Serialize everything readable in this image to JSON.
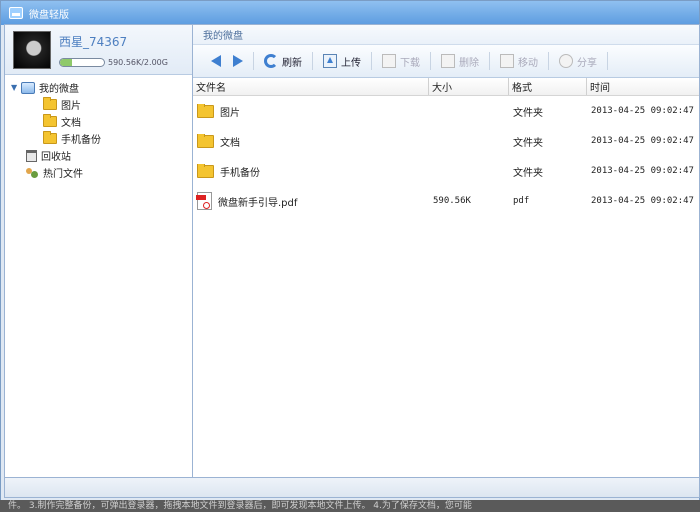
{
  "window": {
    "title": "微盘轻版"
  },
  "profile": {
    "username": "西星_74367",
    "quota_text": "590.56K/2.00G",
    "quota_fraction": 0.28
  },
  "tree": {
    "root_label": "我的微盘",
    "children": [
      "图片",
      "文档",
      "手机备份"
    ],
    "recycle_label": "回收站",
    "hot_label": "热门文件"
  },
  "breadcrumb": "我的微盘",
  "toolbar": {
    "refresh": "刷新",
    "upload": "上传",
    "download": "下载",
    "delete": "删除",
    "move": "移动",
    "share": "分享"
  },
  "columns": {
    "name": "文件名",
    "size": "大小",
    "format": "格式",
    "time": "时间"
  },
  "files": [
    {
      "name": "图片",
      "size": "",
      "format": "文件夹",
      "time": "2013-04-25 09:02:47",
      "icon": "folder-icon"
    },
    {
      "name": "文档",
      "size": "",
      "format": "文件夹",
      "time": "2013-04-25 09:02:47",
      "icon": "folder-icon"
    },
    {
      "name": "手机备份",
      "size": "",
      "format": "文件夹",
      "time": "2013-04-25 09:02:47",
      "icon": "folder-icon"
    },
    {
      "name": "微盘新手引导.pdf",
      "size": "590.56K",
      "format": "pdf",
      "time": "2013-04-25 09:02:47",
      "icon": "pdf-icon"
    }
  ],
  "background_text": "件。  3.制作完整备份，可弹出登录器，拖拽本地文件到登录器后，即可发现本地文件上传。 4.为了保存文档，您可能"
}
